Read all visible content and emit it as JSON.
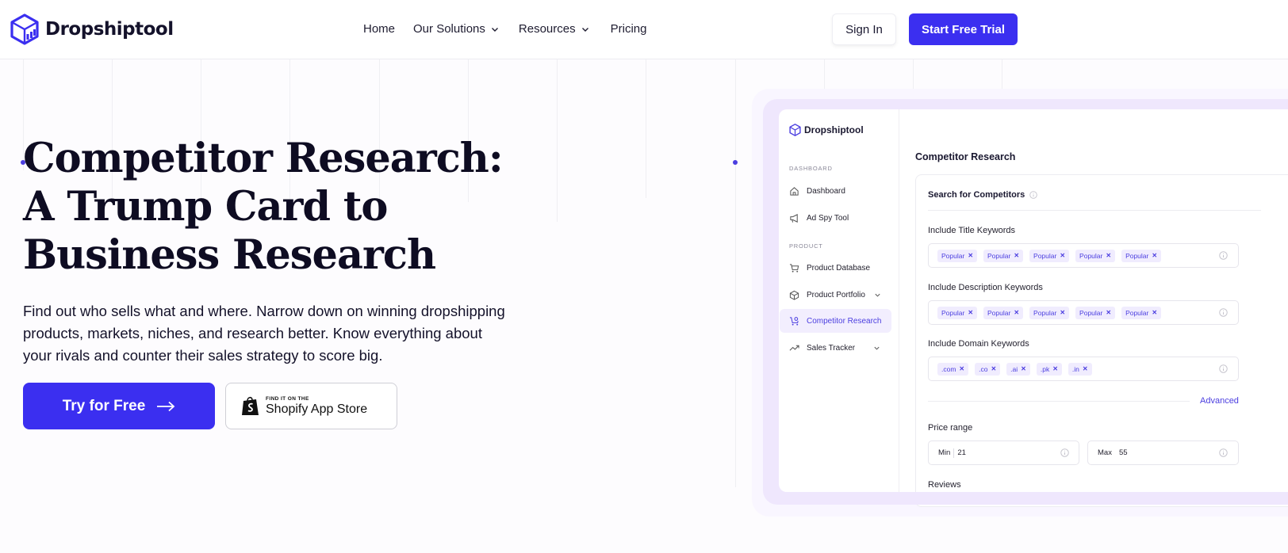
{
  "brand": {
    "name": "Dropshiptool",
    "accent": "#3b2ff0"
  },
  "nav": {
    "items": [
      {
        "label": "Home",
        "dropdown": false
      },
      {
        "label": "Our Solutions",
        "dropdown": true
      },
      {
        "label": "Resources",
        "dropdown": true
      },
      {
        "label": "Pricing",
        "dropdown": false
      }
    ],
    "sign_in": "Sign In",
    "start_trial": "Start Free Trial"
  },
  "hero": {
    "title": "Competitor Research: A Trump Card to Business Research",
    "description": "Find out who sells what and where. Narrow down on winning dropshipping products, markets, niches, and research better. Know everything about your rivals and counter their sales strategy to score big.",
    "cta_primary": "Try for Free",
    "shopify_small": "FIND IT ON THE",
    "shopify_big": "Shopify App Store"
  },
  "mockup": {
    "logo": "Dropshiptool",
    "sections": {
      "dashboard": "DASHBOARD",
      "product": "PRODUCT"
    },
    "sidebar": {
      "dashboard": "Dashboard",
      "ad_spy": "Ad Spy Tool",
      "product_database": "Product Database",
      "product_portfolio": "Product Portfolio",
      "competitor_research": "Competitor Research",
      "sales_tracker": "Sales Tracker"
    },
    "page_title": "Competitor Research",
    "card_title": "Search for Competitors",
    "title_keywords": {
      "label": "Include Title Keywords",
      "tags": [
        "Popular",
        "Popular",
        "Popular",
        "Popular",
        "Popular"
      ]
    },
    "description_keywords": {
      "label": "Include Description Keywords",
      "tags": [
        "Popular",
        "Popular",
        "Popular",
        "Popular",
        "Popular"
      ]
    },
    "domain_keywords": {
      "label": "Include Domain Keywords",
      "tags": [
        ".com",
        ".co",
        ".ai",
        ".pk",
        ".in"
      ]
    },
    "advanced": "Advanced",
    "price_range": {
      "label": "Price range",
      "min_label": "Min",
      "min_value": "21",
      "max_label": "Max",
      "max_value": "55"
    },
    "reviews_label": "Reviews"
  }
}
